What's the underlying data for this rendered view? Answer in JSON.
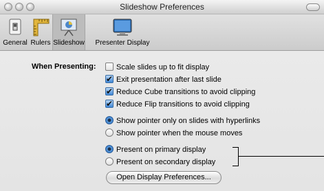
{
  "window": {
    "title": "Slideshow Preferences"
  },
  "toolbar": {
    "items": [
      {
        "label": "General",
        "icon": "general-switch-icon",
        "selected": false
      },
      {
        "label": "Rulers",
        "icon": "ruler-icon",
        "selected": false
      },
      {
        "label": "Slideshow",
        "icon": "slideshow-icon",
        "selected": true
      },
      {
        "label": "Presenter Display",
        "icon": "monitor-icon",
        "selected": false
      }
    ]
  },
  "main": {
    "section_label": "When Presenting:",
    "checkboxes": [
      {
        "label": "Scale slides up to fit display",
        "checked": false
      },
      {
        "label": "Exit presentation after last slide",
        "checked": true
      },
      {
        "label": "Reduce Cube transitions to avoid clipping",
        "checked": true
      },
      {
        "label": "Reduce Flip transitions to avoid clipping",
        "checked": true
      }
    ],
    "pointer_radios": [
      {
        "label": "Show pointer only on slides with hyperlinks",
        "selected": true
      },
      {
        "label": "Show pointer when the mouse moves",
        "selected": false
      }
    ],
    "display_radios": [
      {
        "label": "Present on primary display",
        "selected": true
      },
      {
        "label": "Present on secondary display",
        "selected": false
      }
    ],
    "open_display_button": "Open Display Preferences..."
  },
  "colors": {
    "accent": "#3d86d6"
  }
}
